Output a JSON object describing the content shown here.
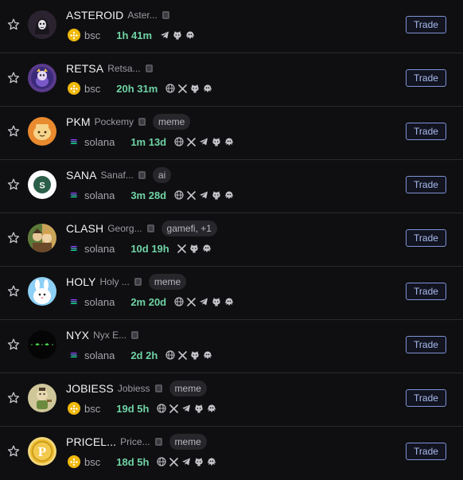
{
  "colors": {
    "background": "#0f0f11",
    "divider": "#2a2a2f",
    "age_green": "#6fd3a5",
    "trade_border": "#7d93d6",
    "bsc_yellow": "#f0b90b"
  },
  "rows": [
    {
      "symbol": "ASTEROID",
      "name": "Aster...",
      "tag": "",
      "chain": "bsc",
      "age": "1h 41m",
      "socials": [
        "telegram-icon",
        "github-icon",
        "dexscreener-icon"
      ],
      "trade_label": "Trade",
      "avatar": "asteroid-avatar"
    },
    {
      "symbol": "RETSA",
      "name": "Retsa...",
      "tag": "",
      "chain": "bsc",
      "age": "20h 31m",
      "socials": [
        "globe-icon",
        "x-icon",
        "github-icon",
        "dexscreener-icon"
      ],
      "trade_label": "Trade",
      "avatar": "retsa-avatar"
    },
    {
      "symbol": "PKM",
      "name": "Pockemy",
      "tag": "meme",
      "chain": "solana",
      "age": "1m 13d",
      "socials": [
        "globe-icon",
        "x-icon",
        "telegram-icon",
        "github-icon",
        "dexscreener-icon"
      ],
      "trade_label": "Trade",
      "avatar": "pkm-avatar"
    },
    {
      "symbol": "SANA",
      "name": "Sanaf...",
      "tag": "ai",
      "chain": "solana",
      "age": "3m 28d",
      "socials": [
        "globe-icon",
        "x-icon",
        "telegram-icon",
        "github-icon",
        "dexscreener-icon"
      ],
      "trade_label": "Trade",
      "avatar": "sana-avatar",
      "avatar_letter": "S"
    },
    {
      "symbol": "CLASH",
      "name": "Georg...",
      "tag": "gamefi, +1",
      "chain": "solana",
      "age": "10d 19h",
      "socials": [
        "x-icon",
        "github-icon",
        "dexscreener-icon"
      ],
      "trade_label": "Trade",
      "avatar": "clash-avatar"
    },
    {
      "symbol": "HOLY",
      "name": "Holy ...",
      "tag": "meme",
      "chain": "solana",
      "age": "2m 20d",
      "socials": [
        "globe-icon",
        "x-icon",
        "telegram-icon",
        "github-icon",
        "dexscreener-icon"
      ],
      "trade_label": "Trade",
      "avatar": "holy-avatar"
    },
    {
      "symbol": "NYX",
      "name": "Nyx E...",
      "tag": "",
      "chain": "solana",
      "age": "2d 2h",
      "socials": [
        "globe-icon",
        "x-icon",
        "github-icon",
        "dexscreener-icon"
      ],
      "trade_label": "Trade",
      "avatar": "nyx-avatar"
    },
    {
      "symbol": "JOBIESS",
      "name": "Jobiess",
      "tag": "meme",
      "chain": "bsc",
      "age": "19d 5h",
      "socials": [
        "globe-icon",
        "x-icon",
        "telegram-icon",
        "github-icon",
        "dexscreener-icon"
      ],
      "trade_label": "Trade",
      "avatar": "jobiess-avatar"
    },
    {
      "symbol": "PRICEL...",
      "name": "Price...",
      "tag": "meme",
      "chain": "bsc",
      "age": "18d 5h",
      "socials": [
        "globe-icon",
        "x-icon",
        "telegram-icon",
        "github-icon",
        "dexscreener-icon"
      ],
      "trade_label": "Trade",
      "avatar": "pricel-avatar"
    }
  ]
}
